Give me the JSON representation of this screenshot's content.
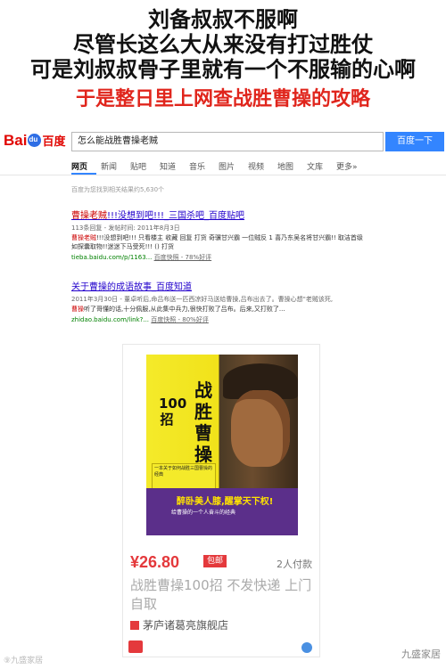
{
  "meme": {
    "line1": "刘备叔叔不服啊",
    "line2": "尽管长这么大从来没有打过胜仗",
    "line3": "可是刘叔叔骨子里就有一个不服输的心啊",
    "line4": "于是整日里上网查战胜曹操的攻略"
  },
  "baidu": {
    "logo_text": "Bai",
    "logo_cn": "百度",
    "search_query": "怎么能战胜曹操老贼",
    "search_button": "百度一下",
    "tabs": [
      "网页",
      "新闻",
      "贴吧",
      "知道",
      "音乐",
      "图片",
      "视频",
      "地图",
      "文库",
      "更多»"
    ],
    "result_count": "百度为您找到相关结果约5,630个",
    "results": [
      {
        "title_hl": "曹操老贼",
        "title_rest": "!!!没想到吧!!!_三国杀吧_百度贴吧",
        "meta": "113条回复 - 发帖时间: 2011年8月3日",
        "snip_hl": "曹操老贼",
        "snip_rest": "!!!没想到吧!!! 只看楼主 收藏 回复 打货 奇骥甘兴霸 一位贼反 1 喜乃东吴名将甘兴霸!! 取洁首级如探囊取物!!迷迷下马受死!!! () 打货",
        "url": "tieba.baidu.com/p/1163...",
        "snapshot": "百度快照 - 78%好评"
      },
      {
        "title_hl": "",
        "title_rest": "关于曹操的成语故事_百度知道",
        "meta": "2011年3月30日 - 董卓听后,命吕布送一匹西凉好马送给曹操,吕布出去了。曹操心想\"老贼该死,",
        "snip_hl": "曹操",
        "snip_rest": "听了哥懂的话,十分佩服,从此集中兵力,很快打败了吕布。后来,又打败了...",
        "url": "zhidao.baidu.com/link?...",
        "snapshot": "百度快照 - 80%好评"
      }
    ]
  },
  "product": {
    "book_title": "战胜曹操",
    "book_num": "100招",
    "book_band": "醉卧美人膝,醒掌天下权!",
    "book_band_sub": "给曹操的一个人奋斗的经典",
    "book_blurb": "一本关于如何战胜三国曹操的经典",
    "price": "¥26.80",
    "price_badge": "包邮",
    "buyers": "2人付款",
    "title": "战胜曹操100招 不发快递 上门自取",
    "shop": "茅庐诸葛亮旗舰店"
  },
  "watermarks": {
    "left": "⑨九盛家居",
    "right": "九盛家居"
  }
}
